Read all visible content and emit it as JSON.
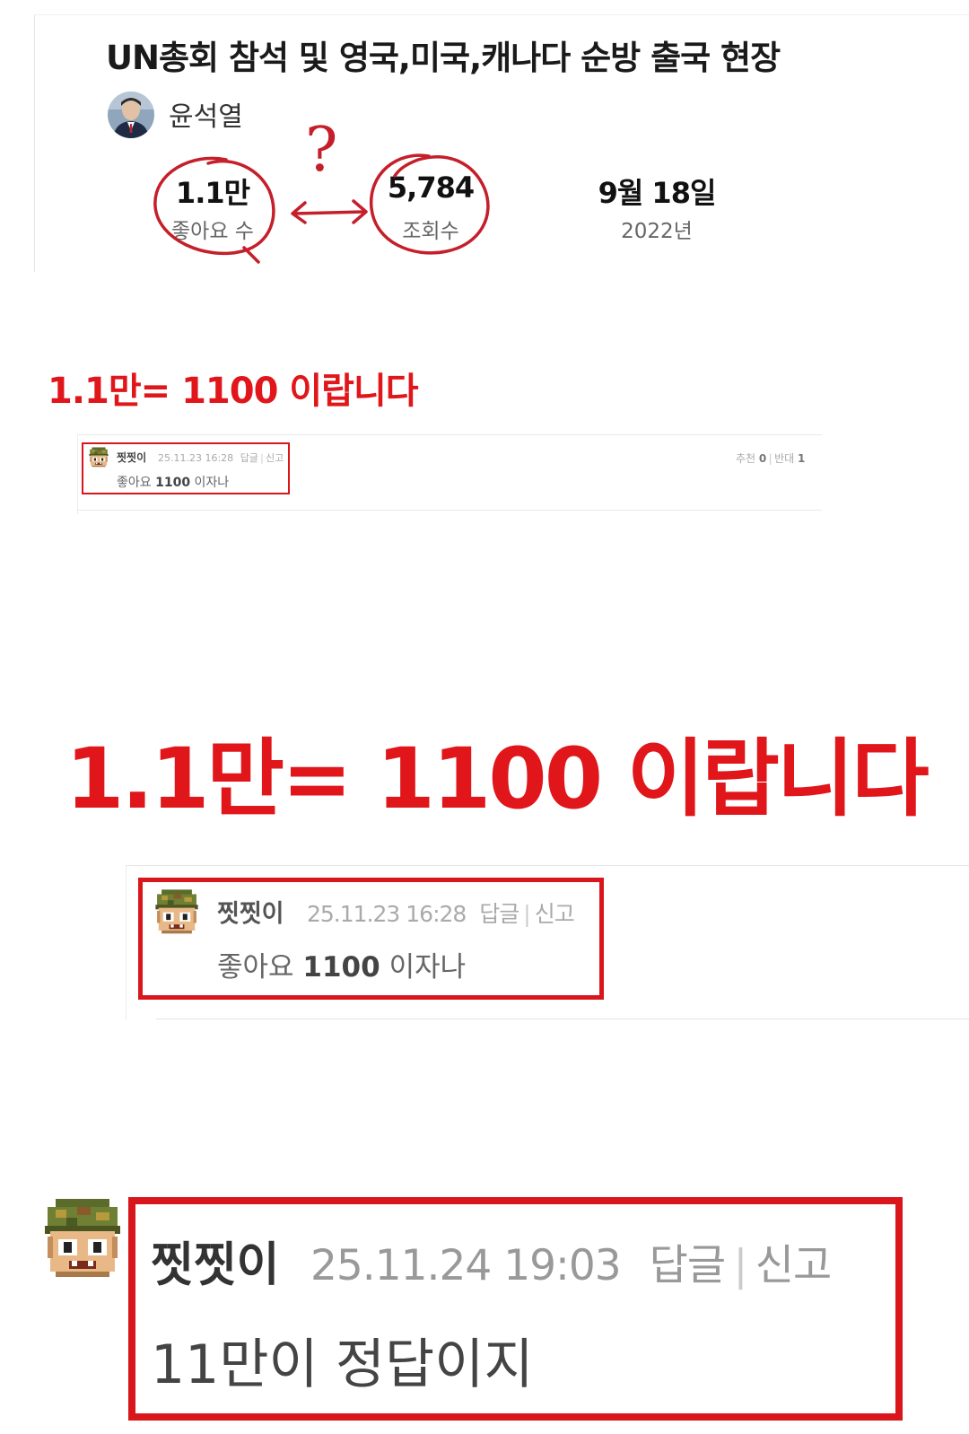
{
  "video": {
    "title": "UN총회 참석 및 영국,미국,캐나다 순방 출국 현장",
    "channel": "윤석열",
    "likes_value": "1.1만",
    "likes_label": "좋아요 수",
    "views_value": "5,784",
    "views_label": "조회수",
    "date_value": "9월 18일",
    "date_year": "2022년",
    "annotation_mark": "?"
  },
  "caption": {
    "text_small": "1.1만= 1100 이랍니다",
    "text_big": "1.1만= 1100 이랍니다"
  },
  "comment1": {
    "author": "찟찟이",
    "timestamp": "25.11.23 16:28",
    "reply_label": "답글",
    "report_label": "신고",
    "body_prefix": "좋아요",
    "body_number": "1100",
    "body_suffix": "이자나",
    "upvote_label": "추천",
    "upvote_count": "0",
    "downvote_label": "반대",
    "downvote_count": "1"
  },
  "comment2": {
    "author": "찟찟이",
    "timestamp": "25.11.24 19:03",
    "reply_label": "답글",
    "report_label": "신고",
    "body": "11만이 정답이지"
  },
  "colors": {
    "highlight_red": "#d8161c",
    "caption_red": "#e0161a",
    "annotation_red": "#c41f2a"
  },
  "icons": {
    "president_avatar": "person-photo-icon",
    "commenter_avatar": "pixel-soldier-avatar-icon"
  }
}
